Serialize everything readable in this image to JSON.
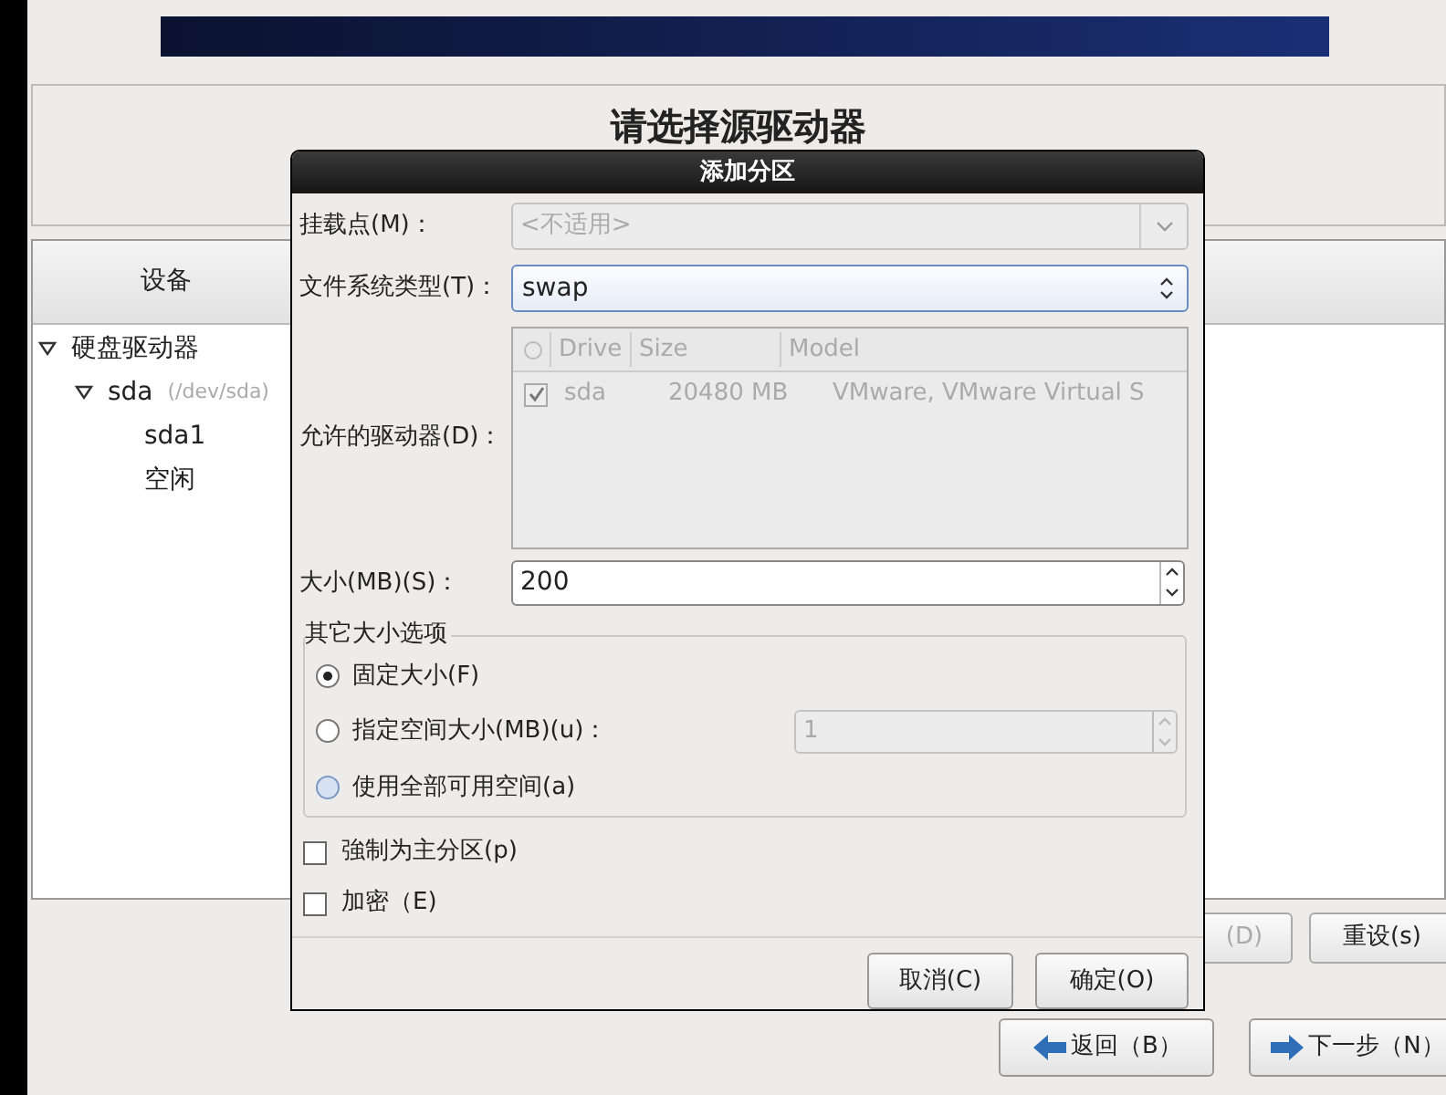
{
  "page_title": "请选择源驱动器",
  "device_panel": {
    "header": "设备",
    "tree": [
      {
        "label": "硬盘驱动器",
        "expanded": true,
        "children": [
          {
            "label": "sda",
            "note": "(/dev/sda)",
            "expanded": true,
            "children": [
              {
                "label": "sda1"
              },
              {
                "label": "空闲"
              }
            ]
          }
        ]
      }
    ]
  },
  "panel_buttons": [
    {
      "label": "(D)",
      "disabled": true
    },
    {
      "label": "重设(s)",
      "disabled": false
    }
  ],
  "nav_buttons": [
    {
      "label": "返回（B）",
      "kind": "back"
    },
    {
      "label": "下一步（N）",
      "kind": "next"
    }
  ],
  "dialog": {
    "title": "添加分区",
    "mount_point": {
      "label": "挂载点(M)：",
      "value": "<不适用>",
      "disabled": true
    },
    "fs_type": {
      "label": "文件系统类型(T)：",
      "value": "swap",
      "disabled": false
    },
    "drives": {
      "label": "允许的驱动器(D)：",
      "columns": [
        "Drive",
        "Size",
        "Model"
      ],
      "rows": [
        {
          "checked": true,
          "cells": [
            "sda",
            "20480 MB",
            "VMware, VMware Virtual S"
          ]
        }
      ]
    },
    "size": {
      "label": "大小(MB)(S)：",
      "value": "200"
    },
    "size_options": {
      "title": "其它大小选项",
      "options": [
        {
          "label": "固定大小(F)",
          "selected": true,
          "kind": "plain"
        },
        {
          "label": "指定空间大小(MB)(u)：",
          "selected": false,
          "kind": "spin",
          "value": "1"
        },
        {
          "label": "使用全部可用空间(a)",
          "selected": false,
          "kind": "plain"
        }
      ]
    },
    "checks": [
      {
        "label": "強制为主分区(p)",
        "checked": false
      },
      {
        "label": "加密（E)",
        "checked": false
      }
    ],
    "buttons": [
      "取消(C)",
      "确定(O)"
    ]
  }
}
